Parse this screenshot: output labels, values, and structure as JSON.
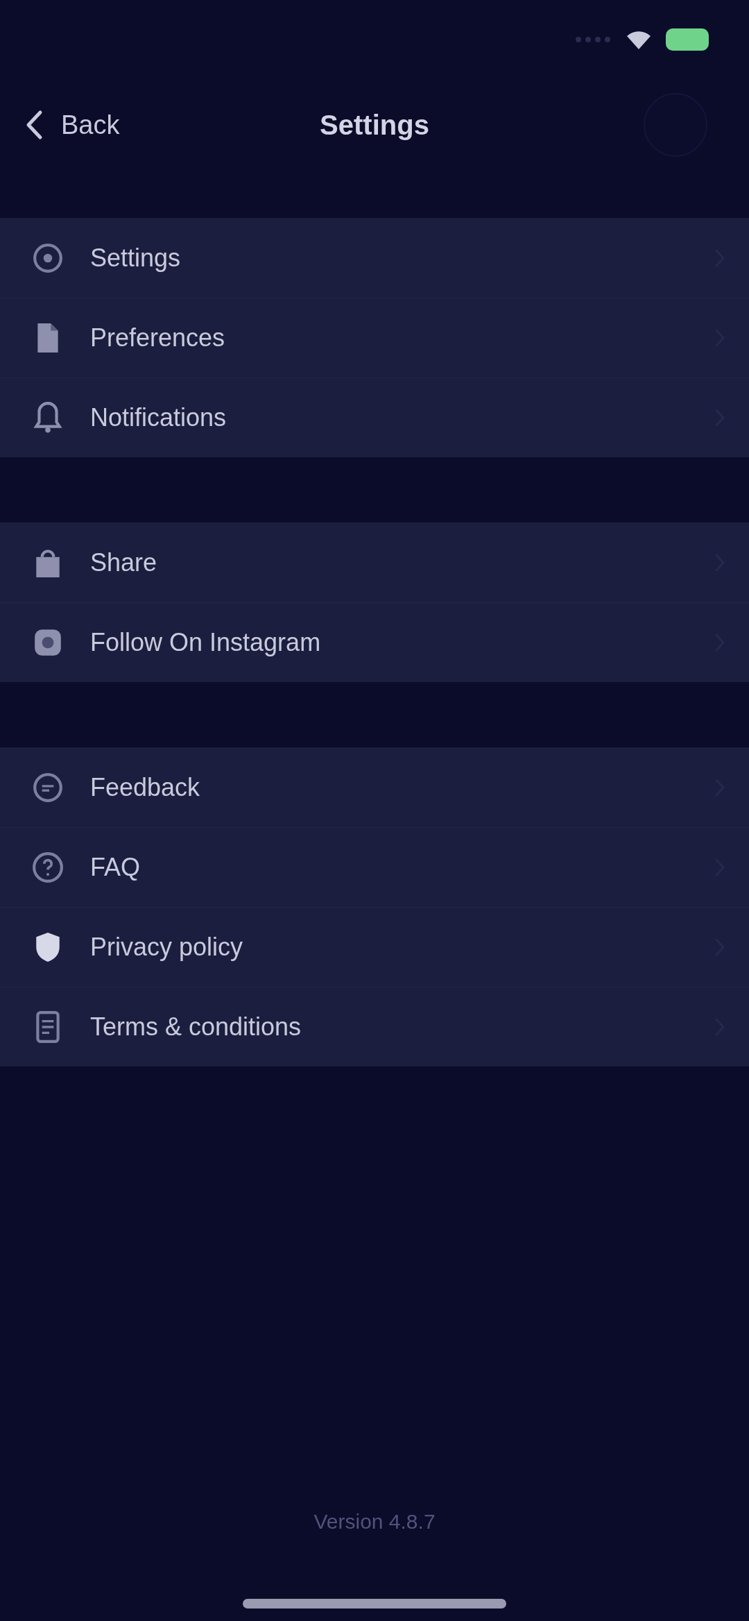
{
  "nav": {
    "back": "Back",
    "title": "Settings"
  },
  "groups": [
    {
      "items": [
        {
          "label": "Settings",
          "kind": "settings"
        },
        {
          "label": "Preferences",
          "kind": "preferences"
        },
        {
          "label": "Notifications",
          "kind": "notifications"
        }
      ]
    },
    {
      "items": [
        {
          "label": "Share",
          "kind": "share"
        },
        {
          "label": "Follow On Instagram",
          "kind": "instagram"
        }
      ]
    },
    {
      "items": [
        {
          "label": "Feedback",
          "kind": "feedback"
        },
        {
          "label": "FAQ",
          "kind": "faq"
        },
        {
          "label": "Privacy policy",
          "kind": "privacy"
        },
        {
          "label": "Terms & conditions",
          "kind": "terms"
        }
      ]
    }
  ],
  "footer": {
    "version": "Version 4.8.7"
  }
}
